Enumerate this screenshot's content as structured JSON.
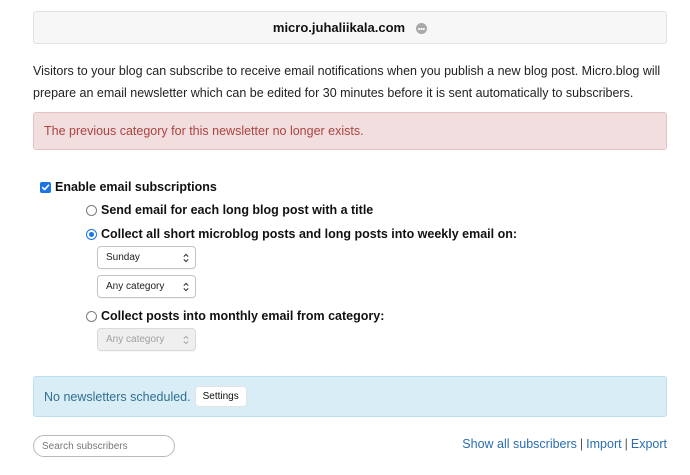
{
  "header": {
    "site_name": "micro.juhaliikala.com",
    "more_icon": "ellipsis-icon"
  },
  "intro": "Visitors to your blog can subscribe to receive email notifications when you publish a new blog post. Micro.blog will prepare an email newsletter which can be edited for 30 minutes before it is sent automatically to subscribers.",
  "alert": {
    "text": "The previous category for this newsletter no longer exists.",
    "color": "#a94442",
    "background": "#f2dede"
  },
  "enable": {
    "label": "Enable email subscriptions",
    "checked": true
  },
  "options": [
    {
      "label": "Send email for each long blog post with a title",
      "selected": false
    },
    {
      "label": "Collect all short microblog posts and long posts into weekly email on:",
      "selected": true
    },
    {
      "label": "Collect posts into monthly email from category:",
      "selected": false
    }
  ],
  "weekly": {
    "day": "Sunday",
    "category": "Any category"
  },
  "monthly": {
    "category": "Any category",
    "disabled": true
  },
  "info": {
    "text": "No newsletters scheduled.",
    "settings_label": "Settings",
    "background": "#d9edf7"
  },
  "search": {
    "placeholder": "Search subscribers",
    "value": ""
  },
  "links": {
    "show_all": "Show all subscribers",
    "import": "Import",
    "export": "Export",
    "separator": "|"
  },
  "accent_color": "#1a73e8"
}
